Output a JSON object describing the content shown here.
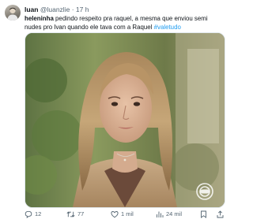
{
  "tweet": {
    "display_name": "luan",
    "handle": "@luanzlie",
    "separator": "·",
    "time": "17 h",
    "text_lead": "heleninha",
    "text_body": " pedindo respeito pra raquel, a mesma que enviou semi nudes pro Ivan quando ele tava com a Raquel ",
    "hashtag": "#valetudo",
    "media_icon": "photo-of-woman",
    "watermark_icon": "globo-logo-icon"
  },
  "actions": {
    "reply": {
      "icon": "reply-icon",
      "count": "12"
    },
    "retweet": {
      "icon": "retweet-icon",
      "count": "77"
    },
    "like": {
      "icon": "heart-icon",
      "count": "1 mil"
    },
    "views": {
      "icon": "views-icon",
      "count": "24 mil"
    },
    "bookmark": {
      "icon": "bookmark-icon"
    },
    "share": {
      "icon": "share-icon"
    }
  },
  "colors": {
    "text": "#0f1419",
    "secondary": "#536471",
    "link": "#1d9bf0"
  }
}
